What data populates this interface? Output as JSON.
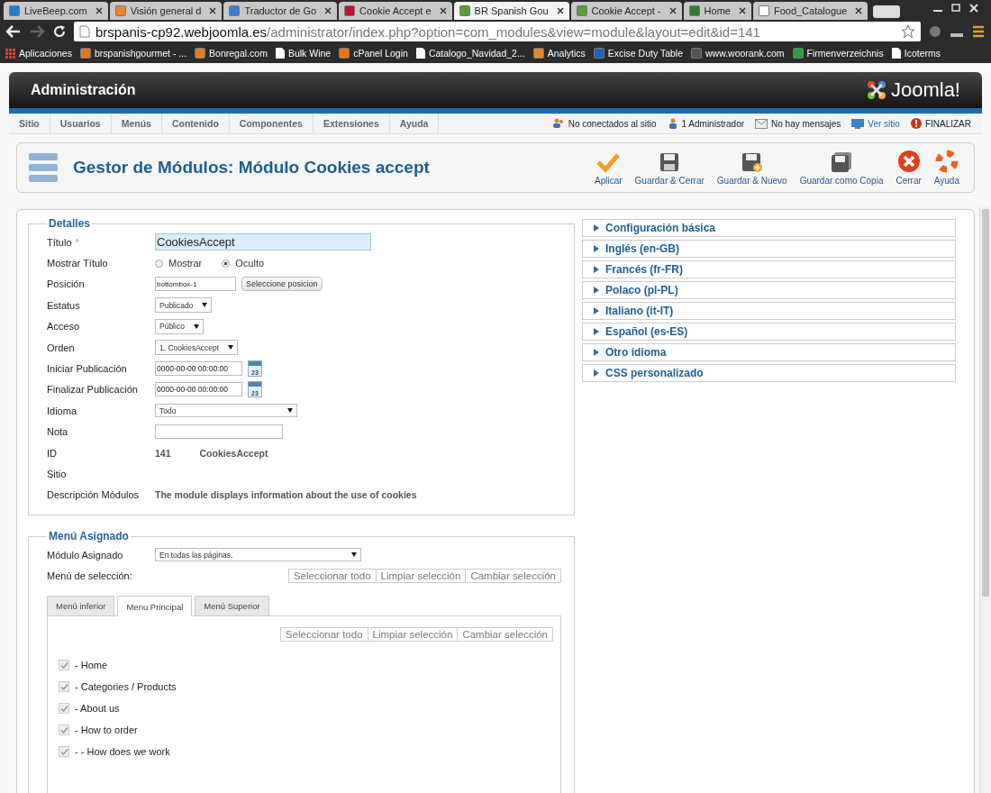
{
  "browser": {
    "tabs": [
      {
        "title": "LiveBeep.com",
        "kind": "feed",
        "selected": false
      },
      {
        "title": "Visión general d",
        "kind": "chart",
        "selected": false
      },
      {
        "title": "Traductor de Go",
        "kind": "translate",
        "selected": false
      },
      {
        "title": "Cookie Accept e",
        "kind": "w",
        "selected": false
      },
      {
        "title": "BR Spanish Gou",
        "kind": "joomla",
        "selected": true
      },
      {
        "title": "Cookie Accept -",
        "kind": "joomla",
        "selected": false
      },
      {
        "title": "Home",
        "kind": "leaf",
        "selected": false
      },
      {
        "title": "Food_Catalogue",
        "kind": "page",
        "selected": false
      }
    ],
    "address": {
      "host": "brspanis-cp92.webjoomla.es",
      "path": "/administrator/index.php?option=com_modules&view=module&layout=edit&id=141"
    },
    "bookmarks": [
      {
        "label": "Aplicaciones",
        "kind": "apps"
      },
      {
        "label": "brspanishgourmet - ...",
        "kind": "joomla"
      },
      {
        "label": "Bonregal.com",
        "kind": "joomla"
      },
      {
        "label": "Bulk Wine",
        "kind": "page"
      },
      {
        "label": "cPanel Login",
        "kind": "cpanel"
      },
      {
        "label": "Catalogo_Navidad_2...",
        "kind": "page"
      },
      {
        "label": "Analytics",
        "kind": "chart"
      },
      {
        "label": "Excise Duty Table",
        "kind": "x"
      },
      {
        "label": "www.woorank.com",
        "kind": "dark"
      },
      {
        "label": "Firmenverzeichnis",
        "kind": "green"
      },
      {
        "label": "Icoterms",
        "kind": "page"
      }
    ]
  },
  "header": {
    "title": "Administración",
    "logo": "Joomla!"
  },
  "menu": [
    "Sitio",
    "Usuarios",
    "Menús",
    "Contenido",
    "Componentes",
    "Extensiones",
    "Ayuda"
  ],
  "status": [
    {
      "kind": "users",
      "text": "No conectados al sitio",
      "link": false
    },
    {
      "kind": "user",
      "text": "1 Administrador",
      "link": false
    },
    {
      "kind": "mail",
      "text": "No hay mensajes",
      "link": false
    },
    {
      "kind": "monitor",
      "text": "Ver sitio",
      "link": true
    },
    {
      "kind": "power",
      "text": "FINALIZAR",
      "link": false
    }
  ],
  "toolbar": {
    "title": "Gestor de Módulos: Módulo Cookies accept",
    "buttons": [
      {
        "kind": "apply",
        "label": "Aplicar"
      },
      {
        "kind": "save",
        "label": "Guardar & Cerrar"
      },
      {
        "kind": "save-new",
        "label": "Guardar & Nuevo"
      },
      {
        "kind": "save-copy",
        "label": "Guardar como Copia"
      },
      {
        "kind": "close",
        "label": "Cerrar"
      },
      {
        "kind": "help",
        "label": "Ayuda"
      }
    ]
  },
  "details": {
    "legend": "Detalles",
    "fields": [
      {
        "kind": "title",
        "label": "Título",
        "required_mark": "*",
        "value": "CookiesAccept"
      },
      {
        "kind": "radio",
        "label": "Mostrar Título",
        "options": [
          {
            "label": "Mostrar",
            "selected": false
          },
          {
            "label": "Oculto",
            "selected": true
          }
        ]
      },
      {
        "kind": "position",
        "label": "Posición",
        "value": "bottombox-1",
        "button": "Seleccione posicion"
      },
      {
        "kind": "select",
        "label": "Estatus",
        "value": "Publicado"
      },
      {
        "kind": "select",
        "label": "Acceso",
        "value": "Público"
      },
      {
        "kind": "select",
        "label": "Orden",
        "value": "1. CookiesAccept"
      },
      {
        "kind": "date",
        "label": "Iniciar Publicación",
        "value": "0000-00-00 00:00:00",
        "calendar": "23"
      },
      {
        "kind": "date",
        "label": "Finalizar Publicación",
        "value": "0000-00-00 00:00:00",
        "calendar": "23"
      },
      {
        "kind": "wide-select",
        "label": "Idioma",
        "value": "Todo"
      },
      {
        "kind": "text",
        "label": "Nota"
      },
      {
        "kind": "static",
        "label": "ID",
        "values": [
          "141",
          "CookiesAccept"
        ]
      },
      {
        "kind": "static",
        "label": "Sitio"
      },
      {
        "kind": "static",
        "label": "Descripción Módulos",
        "values": [
          "The module displays information about the use of cookies"
        ]
      }
    ]
  },
  "assignment": {
    "legend": "Menú Asignado",
    "module_label": "Módulo Asignado",
    "module_value": "En todas las páginas.",
    "selection_label": "Menú de selección:",
    "buttons": [
      "Seleccionar todo",
      "Limpiar selección",
      "Cambiar selección"
    ],
    "tabs": [
      {
        "label": "Menú inferior",
        "selected": false
      },
      {
        "label": "Menu Principal",
        "selected": true
      },
      {
        "label": "Menú Superior",
        "selected": false
      }
    ],
    "panel_buttons": [
      "Seleccionar todo",
      "Limpiar selección",
      "Cambiar selección"
    ],
    "items": [
      {
        "label": "- Home",
        "checked": true,
        "disabled": true
      },
      {
        "label": "- Categories / Products",
        "checked": true,
        "disabled": true
      },
      {
        "label": "- About us",
        "checked": true,
        "disabled": true
      },
      {
        "label": "- How to order",
        "checked": true,
        "disabled": true
      },
      {
        "label": "- - How does we work",
        "checked": true,
        "disabled": true
      }
    ]
  },
  "accordion": [
    {
      "label": "Configuración básica",
      "expanded": false
    },
    {
      "label": "Inglés (en-GB)",
      "expanded": false
    },
    {
      "label": "Francés (fr-FR)",
      "expanded": false
    },
    {
      "label": "Polaco (pl-PL)",
      "expanded": false
    },
    {
      "label": "Italiano (it-IT)",
      "expanded": false
    },
    {
      "label": "Español (es-ES)",
      "expanded": false
    },
    {
      "label": "Otro idioma",
      "expanded": false
    },
    {
      "label": "CSS personalizado",
      "expanded": false
    }
  ]
}
